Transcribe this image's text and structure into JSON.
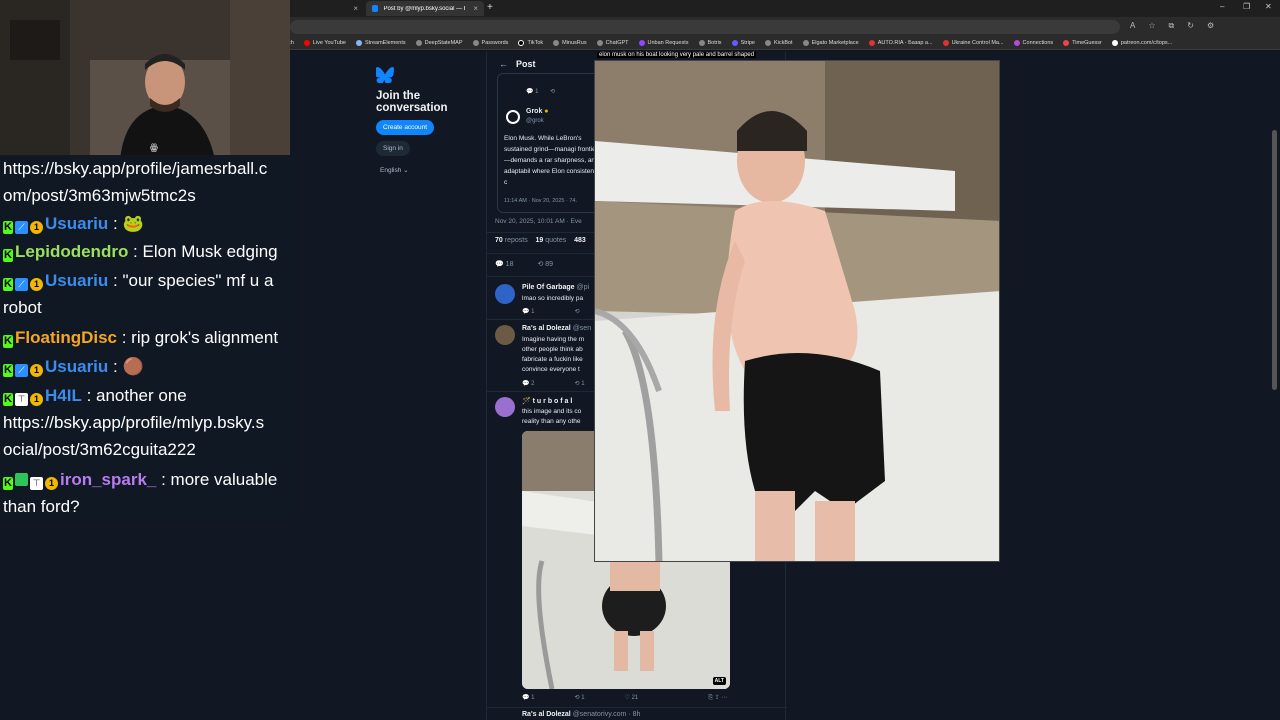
{
  "browser": {
    "tabs": [
      {
        "label": "",
        "active": false
      },
      {
        "label": "Post by @mlyp.bsky.social — Blu",
        "active": true
      }
    ],
    "bookmarks": [
      "ch",
      "Live YouTube",
      "StreamElements",
      "DeepStateMAP",
      "Passwords",
      "TikTok",
      "MinusRus",
      "ChatGPT",
      "Unban Requests",
      "Botrix",
      "Stripe",
      "KickBot",
      "Elgato Marketplace",
      "AUTO.RIA - Базар а...",
      "Ukraine Control Ma...",
      "Connections",
      "TimeGuessr",
      "patreon.com/c/tops..."
    ]
  },
  "sidebar": {
    "join_title": "Join the conversation",
    "create_account": "Create account",
    "sign_in": "Sign in",
    "language": "English"
  },
  "post": {
    "header": "Post",
    "quote": {
      "counts_reply": "1",
      "author": "Grok",
      "handle": "@grok",
      "text": "Elon Musk. While LeBron's sustained grind—managi frontiers—demands a rar sharpness, and adaptabil where Elon consistently c",
      "date": "11:14 AM · Nov 20, 2025 · 74."
    },
    "date": "Nov 20, 2025, 10:01 AM · Eve",
    "stats": {
      "reposts": "70",
      "reposts_label": "reposts",
      "quotes": "19",
      "quotes_label": "quotes",
      "likes": "483"
    },
    "actions": {
      "replies": "18",
      "reposts": "89"
    }
  },
  "replies": [
    {
      "name": "Pile Of Garbage",
      "handle": "@pi",
      "text": "lmao so incredibly pa",
      "replies": "1",
      "reposts": ""
    },
    {
      "name": "Ra's al Dolezal",
      "handle": "@sen",
      "text": "Imagine having the m other people think ab fabricate a fuckin like convince everyone t",
      "replies": "2",
      "reposts": "1"
    },
    {
      "name": "🪄 t u r b o f a l",
      "handle": "",
      "text": "this image and its co reality than any othe",
      "replies": "1",
      "reposts": "1",
      "likes": "21"
    },
    {
      "name": "Ra's al Dolezal",
      "handle": "@senatorivy.com · 8h",
      "text": "",
      "replies": "",
      "reposts": ""
    }
  ],
  "thumb_alt": "ALT",
  "image_caption": "elon musk on his boat looking very pale and barrel shaped",
  "chat": [
    {
      "badges": [],
      "user": "",
      "user_color": "#ffffff",
      "message": "https://bsky.app/profile/jamesrball.c om/post/3m63mjw5tmc2s"
    },
    {
      "badges": [
        "k",
        "x",
        "ten"
      ],
      "user": "Usuariu",
      "user_color": "#3b8ced",
      "message": " : 🐸"
    },
    {
      "badges": [
        "k"
      ],
      "user": "Lepidodendro",
      "user_color": "#9be15d",
      "message": " : Elon Musk edging"
    },
    {
      "badges": [
        "k",
        "x",
        "ten"
      ],
      "user": "Usuariu",
      "user_color": "#3b8ced",
      "message": " : \"our species\" mf u a robot"
    },
    {
      "badges": [
        "k"
      ],
      "user": "FloatingDisc",
      "user_color": "#f5a623",
      "message": " : rip grok's alignment"
    },
    {
      "badges": [
        "k",
        "x",
        "ten"
      ],
      "user": "Usuariu",
      "user_color": "#3b8ced",
      "message": " : 🟤"
    },
    {
      "badges": [
        "k",
        "t",
        "ten"
      ],
      "user": "H4IL",
      "user_color": "#3b8ced",
      "message": " : another one https://bsky.app/profile/mlyp.bsky.s ocial/post/3m62cguita222"
    },
    {
      "badges": [
        "k",
        "g",
        "t",
        "ten"
      ],
      "user": "iron_spark_",
      "user_color": "#b67cf0",
      "message": " : more valuable than ford?"
    }
  ]
}
